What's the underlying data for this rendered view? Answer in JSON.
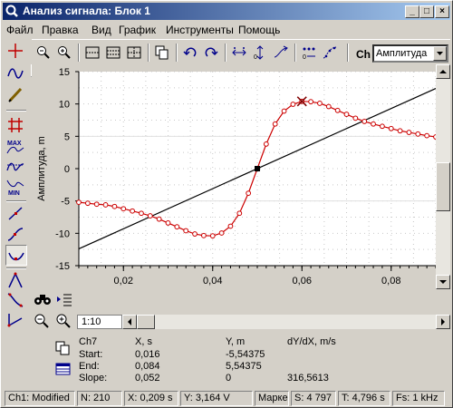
{
  "window": {
    "title": "Анализ сигнала: Блок 1",
    "min": "_",
    "max": "□",
    "close": "×"
  },
  "menu": [
    {
      "label": "Файл"
    },
    {
      "label": "Правка"
    },
    {
      "label": "Вид"
    },
    {
      "label": "График"
    },
    {
      "label": "Инструменты"
    },
    {
      "label": "Помощь"
    }
  ],
  "toolbar": {
    "channel_label": "Ch",
    "channel_value": "Амплитуда"
  },
  "chart_data": {
    "type": "line",
    "ylabel": "Амплитуда, m",
    "xlim": [
      0.01,
      0.09
    ],
    "ylim": [
      -15,
      15
    ],
    "y_ticks": [
      15,
      10,
      5,
      0,
      -5,
      -10,
      -15
    ],
    "x_ticks": [
      0.02,
      0.04,
      0.06,
      0.08
    ],
    "x_tick_labels": [
      "0,02",
      "0,04",
      "0,06",
      "0,08"
    ],
    "y_tick_labels": [
      "15",
      "10",
      "5",
      "0",
      "-5",
      "-10",
      "-15"
    ],
    "grid": true,
    "series": [
      {
        "color": "#cc0000",
        "points": [
          [
            0.01,
            -5.2
          ],
          [
            0.012,
            -5.35
          ],
          [
            0.014,
            -5.5
          ],
          [
            0.016,
            -5.6
          ],
          [
            0.018,
            -5.85
          ],
          [
            0.02,
            -6.2
          ],
          [
            0.022,
            -6.55
          ],
          [
            0.024,
            -6.9
          ],
          [
            0.026,
            -7.3
          ],
          [
            0.028,
            -7.8
          ],
          [
            0.03,
            -8.4
          ],
          [
            0.032,
            -9.0
          ],
          [
            0.034,
            -9.6
          ],
          [
            0.036,
            -10.1
          ],
          [
            0.038,
            -10.35
          ],
          [
            0.04,
            -10.4
          ],
          [
            0.042,
            -9.95
          ],
          [
            0.044,
            -8.9
          ],
          [
            0.046,
            -6.9
          ],
          [
            0.048,
            -3.8
          ],
          [
            0.05,
            0.0
          ],
          [
            0.052,
            3.8
          ],
          [
            0.054,
            6.9
          ],
          [
            0.056,
            8.9
          ],
          [
            0.058,
            9.95
          ],
          [
            0.06,
            10.4
          ],
          [
            0.062,
            10.35
          ],
          [
            0.064,
            10.1
          ],
          [
            0.066,
            9.6
          ],
          [
            0.068,
            9.0
          ],
          [
            0.07,
            8.4
          ],
          [
            0.072,
            7.8
          ],
          [
            0.074,
            7.3
          ],
          [
            0.076,
            6.9
          ],
          [
            0.078,
            6.55
          ],
          [
            0.08,
            6.2
          ],
          [
            0.082,
            5.85
          ],
          [
            0.084,
            5.6
          ],
          [
            0.086,
            5.35
          ],
          [
            0.088,
            5.1
          ],
          [
            0.09,
            4.9
          ]
        ]
      },
      {
        "color": "#000000",
        "points": [
          [
            0.01,
            -12.4
          ],
          [
            0.09,
            12.4
          ]
        ]
      }
    ],
    "markers": {
      "cross": [
        0.06,
        10.4
      ],
      "square": [
        0.05,
        0.0
      ]
    }
  },
  "zoom": {
    "value": "1:10"
  },
  "measure": {
    "channel": "Ch7",
    "col_x": "X, s",
    "col_y": "Y, m",
    "col_d": "dY/dX, m/s",
    "start_label": "Start:",
    "start_x": "0,016",
    "start_y": "-5,54375",
    "end_label": "End:",
    "end_x": "0,084",
    "end_y": "5,54375",
    "slope_label": "Slope:",
    "slope_x": "0,052",
    "slope_y": "0",
    "slope_d": "316,5613"
  },
  "status": {
    "state": "Ch1: Modified",
    "n": "N: 210",
    "x": "X: 0,209 s",
    "y": "Y: 3,164 V",
    "marker": "Марке",
    "s": "S: 4 797",
    "t": "T: 4,796 s",
    "fs": "Fs: 1 kHz"
  }
}
